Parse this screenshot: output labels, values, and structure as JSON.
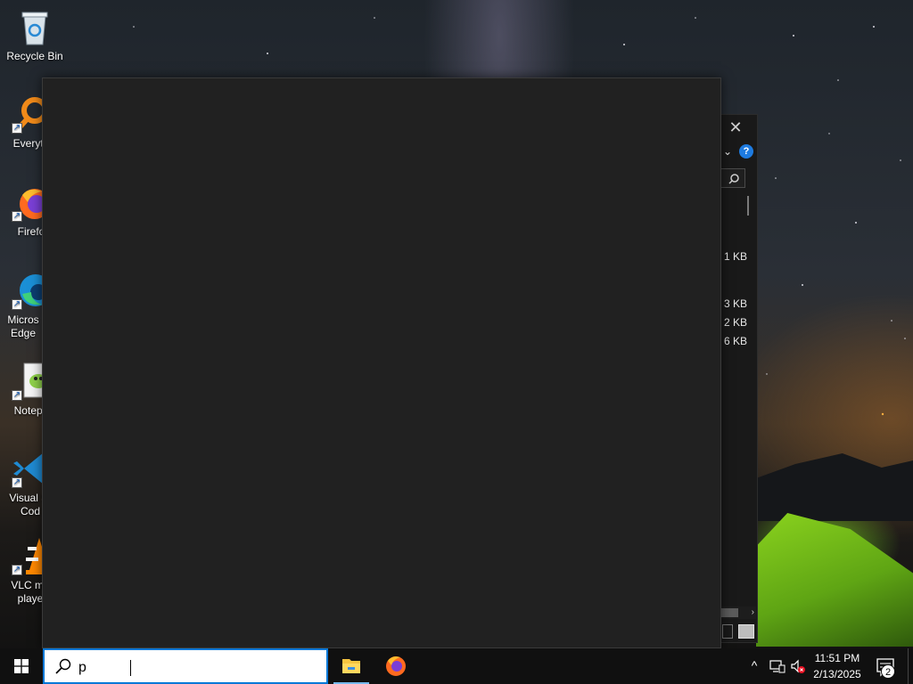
{
  "desktop": {
    "icons": [
      {
        "label": "Recycle Bin",
        "icon": "recycle-bin-icon"
      },
      {
        "label": "Everyth",
        "icon": "everything-search-icon"
      },
      {
        "label": "Firefo",
        "icon": "firefox-icon"
      },
      {
        "label": "Micros Edge",
        "icon": "edge-icon"
      },
      {
        "label": "Notepa",
        "icon": "notepad-plus-plus-icon"
      },
      {
        "label": "Visual St Cod",
        "icon": "vscode-icon"
      },
      {
        "label": "VLC me playe",
        "icon": "vlc-icon"
      }
    ]
  },
  "explorer_window": {
    "close_glyph": "✕",
    "chevron_glyph": "⌄",
    "help_glyph": "?",
    "file_sizes": [
      "1 KB",
      "3 KB",
      "2 KB",
      "6 KB"
    ]
  },
  "search_panel": {
    "state": "open, empty results"
  },
  "taskbar": {
    "search": {
      "value": "p",
      "icon": "search-icon"
    },
    "apps": [
      {
        "name": "File Explorer",
        "icon": "file-explorer-icon",
        "active": true
      },
      {
        "name": "Firefox",
        "icon": "firefox-icon",
        "active": false
      }
    ],
    "tray": {
      "chevron": "^",
      "network_icon": "network-icon",
      "volume_icon": "volume-muted-icon"
    },
    "clock": {
      "time": "11:51 PM",
      "date": "2/13/2025"
    },
    "notifications": {
      "count": "2",
      "icon": "action-center-icon"
    }
  },
  "colors": {
    "taskbar_bg": "#101010",
    "search_border": "#0078d7",
    "panel_bg": "#212121",
    "accent": "#76b9ed"
  }
}
